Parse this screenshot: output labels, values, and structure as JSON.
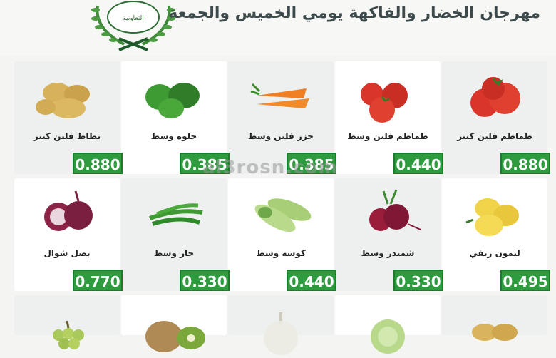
{
  "header": {
    "title": "مهرجان الخضار والفاكهة يومي الخميس والجمعة",
    "logo_text": "التعاونية"
  },
  "watermark": "al3rosn.com",
  "products": [
    {
      "name": "طماطم فلين كبير",
      "price": "0.880",
      "icon": "tomato-icon"
    },
    {
      "name": "طماطم فلين وسط",
      "price": "0.440",
      "icon": "tomato-icon"
    },
    {
      "name": "جزر فلين وسط",
      "price": "0.385",
      "icon": "carrot-icon"
    },
    {
      "name": "حلوه وسط",
      "price": "0.385",
      "icon": "pepper-icon"
    },
    {
      "name": "بطاط فلين كبير",
      "price": "0.880",
      "icon": "potato-icon"
    },
    {
      "name": "ليمون ريفي",
      "price": "0.495",
      "icon": "lemon-icon"
    },
    {
      "name": "شمندر وسط",
      "price": "0.330",
      "icon": "beet-icon"
    },
    {
      "name": "كوسة وسط",
      "price": "0.440",
      "icon": "zucchini-icon"
    },
    {
      "name": "حار وسط",
      "price": "0.330",
      "icon": "chili-icon"
    },
    {
      "name": "بصل شوال",
      "price": "0.770",
      "icon": "onion-icon"
    }
  ],
  "colors": {
    "price_bg": "#2e9b3e",
    "title": "#3c4a4c"
  }
}
